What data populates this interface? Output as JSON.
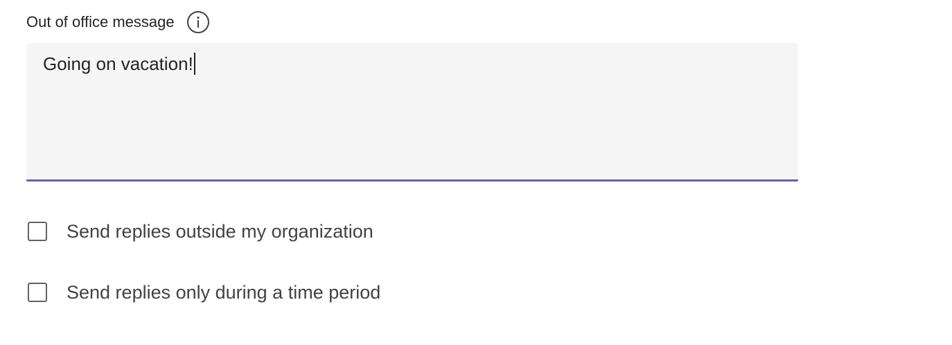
{
  "message_field": {
    "label": "Out of office message",
    "info_icon": "info-circle-icon",
    "value": "Going on vacation!"
  },
  "options": [
    {
      "label": "Send replies outside my organization",
      "checked": false
    },
    {
      "label": "Send replies only during a time period",
      "checked": false
    }
  ],
  "colors": {
    "accent": "#6264a7",
    "input_background": "#f5f5f5",
    "text": "#242424"
  }
}
